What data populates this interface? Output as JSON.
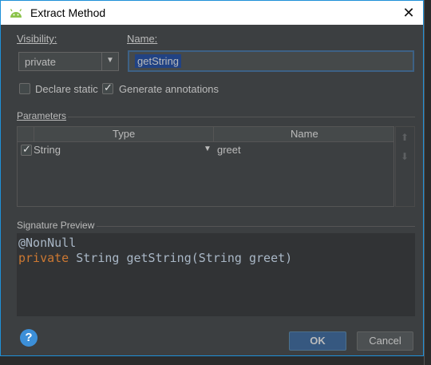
{
  "window": {
    "title": "Extract Method",
    "close_glyph": "✕"
  },
  "visibility": {
    "label": "Visibility:",
    "value": "private",
    "arrow": "▼"
  },
  "name": {
    "label": "Name:",
    "value": "getString"
  },
  "options": {
    "declare_static": {
      "label": "Declare static",
      "checked": false
    },
    "generate_annotations": {
      "label": "Generate annotations",
      "checked": true
    }
  },
  "parameters": {
    "section_title": "Parameters",
    "columns": [
      "Type",
      "Name"
    ],
    "rows": [
      {
        "checked": true,
        "type": "String",
        "name": "greet",
        "dropdown": "▼"
      }
    ],
    "move_up_glyph": "⬆",
    "move_down_glyph": "⬇"
  },
  "signature": {
    "section_title": "Signature Preview",
    "annotation": "@NonNull",
    "keyword": "private",
    "rest": " String getString(String greet)"
  },
  "buttons": {
    "help": "?",
    "ok": "OK",
    "cancel": "Cancel"
  },
  "colors": {
    "accent": "#365880",
    "keyword": "#cc7832",
    "selection": "#214283",
    "dialog_bg": "#3c3f41"
  },
  "icons": {
    "title": "android-icon"
  }
}
